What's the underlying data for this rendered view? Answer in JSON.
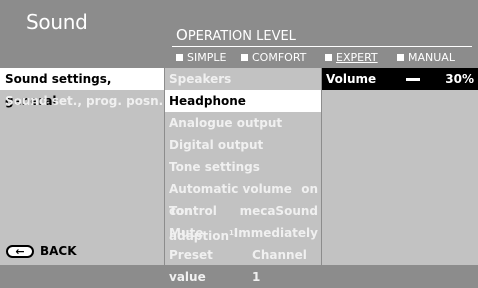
{
  "title": "Sound",
  "operation_level": {
    "label_first": "O",
    "label_rest": "PERATION LEVEL",
    "modes": [
      "SIMPLE",
      "COMFORT",
      "EXPERT",
      "MANUAL"
    ]
  },
  "menu": {
    "items": [
      "Sound settings, general",
      "Sound set., prog. posn."
    ]
  },
  "submenu": {
    "items": [
      {
        "label": "Speakers",
        "value": ""
      },
      {
        "label": "Headphone",
        "value": ""
      },
      {
        "label": "Analogue output",
        "value": ""
      },
      {
        "label": "Digital output",
        "value": ""
      },
      {
        "label": "Tone settings",
        "value": ""
      },
      {
        "label": "Automatic volume control",
        "value": "on"
      },
      {
        "label": "Ton adaption",
        "sup": "1)",
        "value": "mecaSound"
      },
      {
        "label": "Mute",
        "value": "Immediately"
      },
      {
        "label": "Preset value",
        "value": "Channel 1"
      }
    ]
  },
  "detail": {
    "volume_label": "Volume",
    "volume_value": "30%",
    "volume_level": 0.3
  },
  "back_label": "BACK"
}
